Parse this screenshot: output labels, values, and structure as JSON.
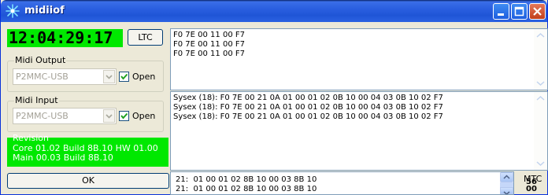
{
  "window": {
    "title": "midiiof"
  },
  "timecode": "12:04:29:17",
  "ltc_button": "LTC",
  "midi_output": {
    "label": "Midi Output",
    "value": "P2MMC-USB",
    "open_label": "Open",
    "open_checked": true
  },
  "midi_input": {
    "label": "Midi Input",
    "value": "P2MMC-USB",
    "open_label": "Open",
    "open_checked": true
  },
  "revision": {
    "label": "Revision",
    "lines": [
      "Core 01.02 Build 8B.10 HW 01.00",
      "Main 00.03 Build 8B.10"
    ]
  },
  "ok_button": "OK",
  "log_top": [
    "F0 7E 00 11 00 F7",
    "F0 7E 00 11 00 F7",
    "F0 7E 00 11 00 F7"
  ],
  "log_sysex": [
    "Sysex (18): F0 7E 00 21 0A 01 00 01 02 0B 10 00 04 03 0B 10 02 F7",
    "Sysex (18): F0 7E 00 21 0A 01 00 01 02 0B 10 00 04 03 0B 10 02 F7",
    "Sysex (18): F0 7E 00 21 0A 01 00 01 02 0B 10 00 04 03 0B 10 02 F7"
  ],
  "log_bottom": [
    "21:  01 00 01 02 8B 10 00 03 8B 10",
    "21:  01 00 01 02 8B 10 00 03 8B 10"
  ],
  "mtc": {
    "label": "MTC",
    "value1": "56",
    "value2": "00"
  },
  "colors": {
    "timecode_bg": "#00e800",
    "revision_bg": "#00e800",
    "titlebar": "#2a5fe0"
  }
}
